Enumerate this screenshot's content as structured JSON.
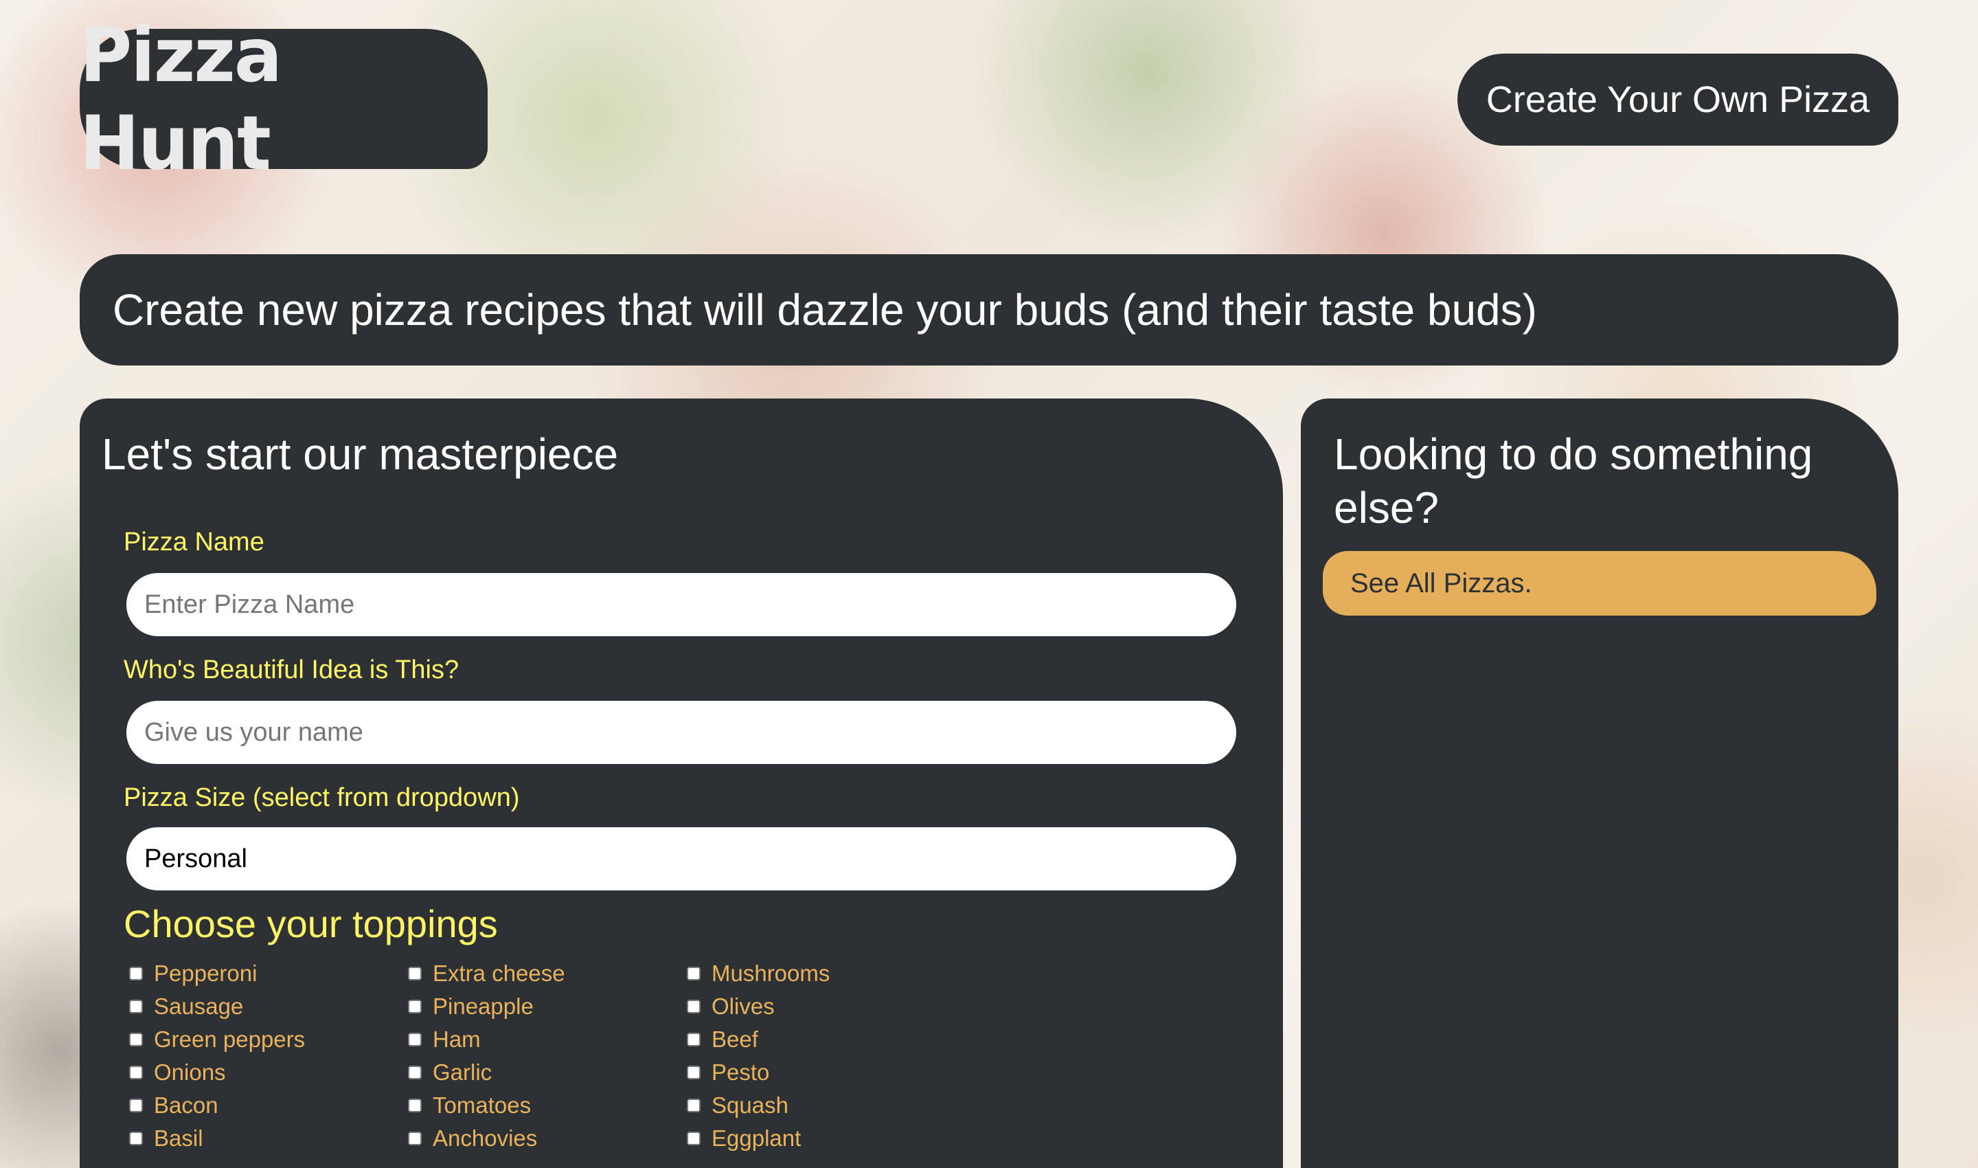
{
  "header": {
    "logo_text": "Pizza Hunt",
    "nav_button_label": "Create Your Own Pizza"
  },
  "banner": {
    "text": "Create new pizza recipes that will dazzle your buds (and their taste buds)"
  },
  "form": {
    "title": "Let's start our masterpiece",
    "pizza_name": {
      "label": "Pizza Name",
      "placeholder": "Enter Pizza Name"
    },
    "creator": {
      "label": "Who's Beautiful Idea is This?",
      "placeholder": "Give us your name"
    },
    "size": {
      "label": "Pizza Size (select from dropdown)",
      "selected": "Personal"
    },
    "toppings": {
      "title": "Choose your toppings",
      "items": [
        "Pepperoni",
        "Sausage",
        "Green peppers",
        "Onions",
        "Bacon",
        "Basil",
        "Extra cheese",
        "Pineapple",
        "Ham",
        "Garlic",
        "Tomatoes",
        "Anchovies",
        "Mushrooms",
        "Olives",
        "Beef",
        "Pesto",
        "Squash",
        "Eggplant"
      ]
    }
  },
  "sidebar": {
    "title": "Looking to do something else?",
    "button_label": "See All Pizzas."
  },
  "colors": {
    "panel": "#2d3134",
    "label_yellow": "#fff566",
    "topping_orange": "#e9b25c",
    "accent_button": "#e4ae5a"
  }
}
